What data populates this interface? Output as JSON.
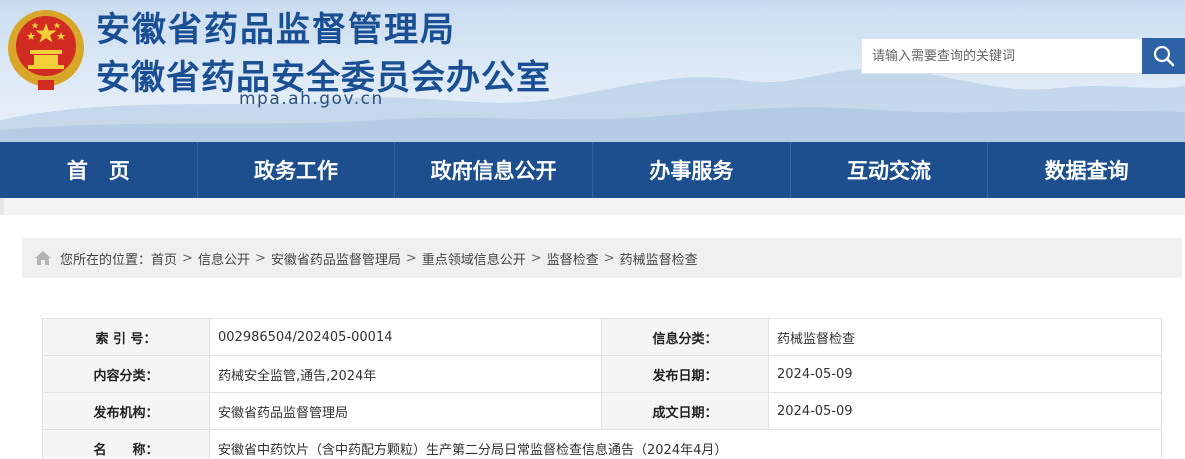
{
  "header": {
    "title_main": "安徽省药品监督管理局",
    "title_sub": "安徽省药品安全委员会办公室",
    "domain": "mpa.ah.gov.cn",
    "search_placeholder": "请输入需要查询的关键词",
    "colors": {
      "brand_blue": "#1a4f94",
      "nav_bg": "#1d4f8f",
      "search_btn": "#2d62a6"
    }
  },
  "nav": {
    "items": [
      {
        "label": "首　页"
      },
      {
        "label": "政务工作"
      },
      {
        "label": "政府信息公开"
      },
      {
        "label": "办事服务"
      },
      {
        "label": "互动交流"
      },
      {
        "label": "数据查询"
      }
    ]
  },
  "breadcrumb": {
    "prefix": "您所在的位置：",
    "items": [
      "首页",
      "信息公开",
      "安徽省药品监督管理局",
      "重点领域信息公开",
      "监督检查",
      "药械监督检查"
    ],
    "separator": ">"
  },
  "info": {
    "index_label": "索 引 号：",
    "index_value": "002986504/202405-00014",
    "category_label": "信息分类：",
    "category_value": "药械监督检查",
    "content_label": "内容分类：",
    "content_value": "药械安全监管,通告,2024年",
    "publish_label": "发布日期：",
    "publish_value": "2024-05-09",
    "org_label": "发布机构：",
    "org_value": "安徽省药品监督管理局",
    "created_label": "成文日期：",
    "created_value": "2024-05-09",
    "name_label": "名　　称：",
    "name_value": "安徽省中药饮片（含中药配方颗粒）生产第二分局日常监督检查信息通告（2024年4月）"
  }
}
